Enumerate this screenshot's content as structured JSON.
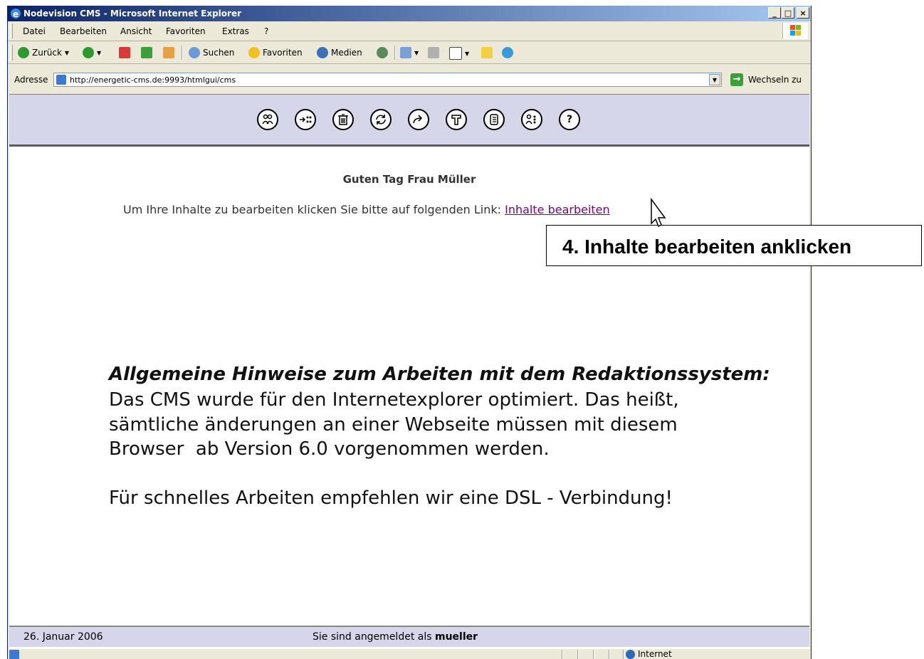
{
  "window": {
    "title": "Nodevision CMS - Microsoft Internet Explorer",
    "controls": [
      "_",
      "□",
      "×"
    ]
  },
  "menu": [
    "Datei",
    "Bearbeiten",
    "Ansicht",
    "Favoriten",
    "Extras",
    "?"
  ],
  "toolbar": {
    "back": "Zurück",
    "search": "Suchen",
    "favorites": "Favoriten",
    "media": "Medien"
  },
  "address": {
    "label": "Adresse",
    "url": "http://energetic-cms.de:9993/htmlgui/cms",
    "go": "Wechseln zu"
  },
  "cms_toolbar": {
    "icons": [
      "users-icon",
      "move-icon",
      "trash-icon",
      "refresh-icon",
      "forward-icon",
      "tools-icon",
      "list-icon",
      "group-icon",
      "help-icon"
    ],
    "help_label": "?"
  },
  "page": {
    "greeting": "Guten Tag Frau Müller",
    "instruction": "Um Ihre Inhalte zu bearbeiten klicken Sie bitte auf folgenden Link: ",
    "link": "Inhalte bearbeiten"
  },
  "hints": {
    "title": "Allgemeine Hinweise zum Arbeiten mit dem Redaktionssystem:",
    "line1": "Das CMS wurde für den Internetexplorer optimiert. Das heißt,",
    "line2": "sämtliche änderungen an einer Webseite müssen mit diesem",
    "line3": "Browser  ab Version 6.0 vorgenommen werden.",
    "line4": "Für schnelles Arbeiten empfehlen wir eine DSL - Verbindung!"
  },
  "footer": {
    "date": "26. Januar 2006",
    "login_prefix": "Sie sind angemeldet als ",
    "user": "mueller"
  },
  "status": {
    "zone": "Internet"
  },
  "callout": {
    "text": "4. Inhalte bearbeiten anklicken"
  }
}
